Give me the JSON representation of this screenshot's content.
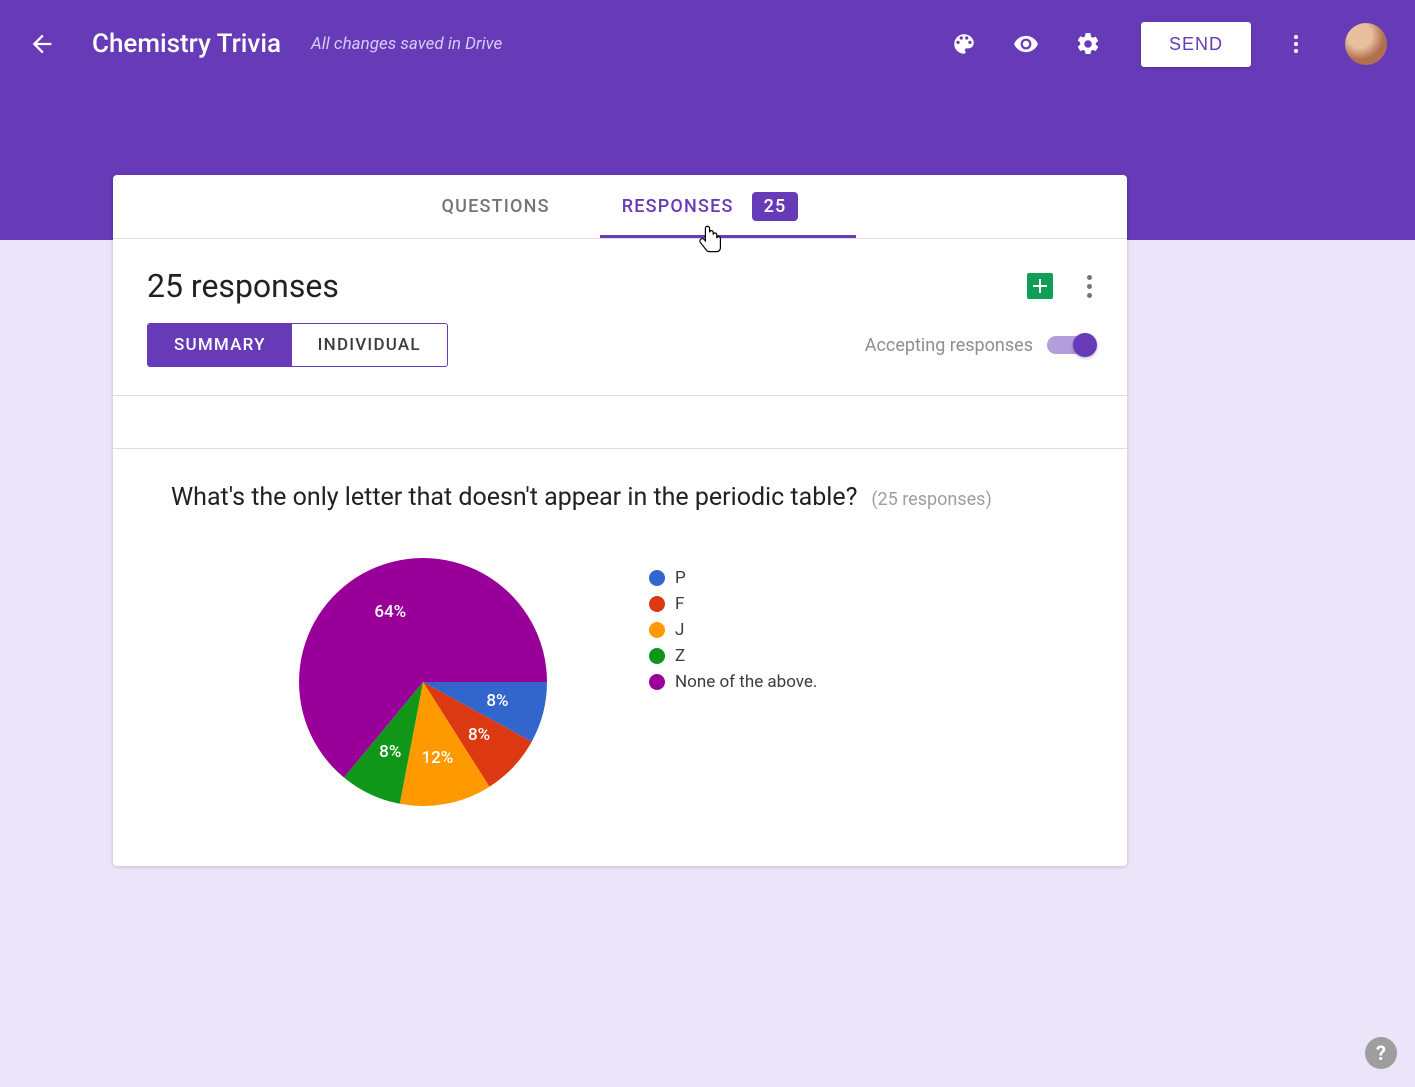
{
  "header": {
    "title": "Chemistry Trivia",
    "save_status": "All changes saved in Drive",
    "send_label": "SEND"
  },
  "tabs": {
    "questions_label": "QUESTIONS",
    "responses_label": "RESPONSES",
    "responses_badge": "25"
  },
  "responses": {
    "title": "25 responses",
    "summary_label": "SUMMARY",
    "individual_label": "INDIVIDUAL",
    "accepting_label": "Accepting responses"
  },
  "question1": {
    "text": "What's the only letter that doesn't appear in the periodic table?",
    "count_label": "(25 responses)",
    "legend": {
      "0": "P",
      "1": "F",
      "2": "J",
      "3": "Z",
      "4": "None of the above."
    }
  },
  "chart_data": {
    "type": "pie",
    "title": "What's the only letter that doesn't appear in the periodic table?",
    "series": [
      {
        "name": "P",
        "value": 8,
        "color": "#3366cc"
      },
      {
        "name": "F",
        "value": 8,
        "color": "#dc3912"
      },
      {
        "name": "J",
        "value": 12,
        "color": "#ff9900"
      },
      {
        "name": "Z",
        "value": 8,
        "color": "#109618"
      },
      {
        "name": "None of the above.",
        "value": 64,
        "color": "#990099"
      }
    ],
    "labels": [
      "8%",
      "8%",
      "12%",
      "8%",
      "64%"
    ]
  }
}
